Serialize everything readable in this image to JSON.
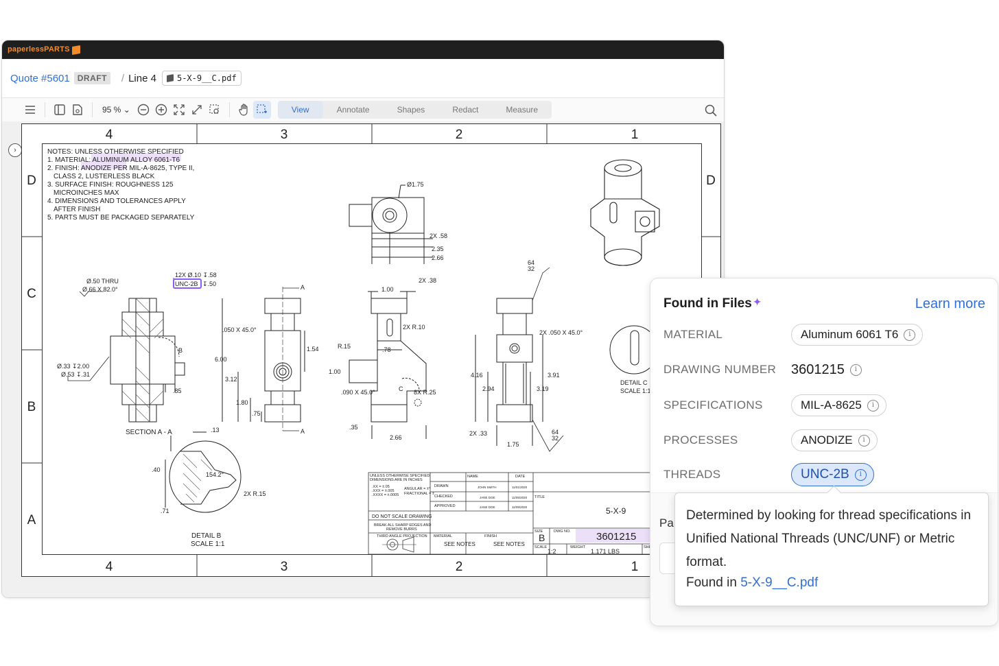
{
  "brand": {
    "name_lower": "paperless",
    "name_upper": "PARTS"
  },
  "header": {
    "quote": "Quote #5601",
    "status": "DRAFT",
    "separator": "/",
    "line": "Line 4",
    "file": "5-X-9__C.pdf"
  },
  "toolbar": {
    "zoom": "95 %",
    "tabs": [
      "View",
      "Annotate",
      "Shapes",
      "Redact",
      "Measure"
    ]
  },
  "drawing": {
    "zones_cols": [
      "4",
      "3",
      "2",
      "1"
    ],
    "zones_rows": [
      "D",
      "C",
      "B",
      "A"
    ],
    "notes": [
      "NOTES: UNLESS OTHERWISE SPECIFIED",
      "1. MATERIAL: ALUMINUM ALLOY 6061-T6",
      "2. FINISH: ANODIZE PER MIL-A-8625, TYPE II,",
      "CLASS 2, LUSTERLESS BLACK",
      "3. SURFACE FINISH: ROUGHNESS 125",
      "MICROINCHES MAX",
      "4. DIMENSIONS AND TOLERANCES APPLY",
      "AFTER FINISH",
      "5. PARTS MUST BE PACKAGED SEPARATELY"
    ],
    "dims": {
      "d175": "Ø1.75",
      "x58": "2X .58",
      "d235": "2.35",
      "d266": "2.66",
      "thru": "Ø.50 THRU",
      "csk": "Ø.66 X 82.0°",
      "holes": "12X Ø.10 ↧.58",
      "thread": "UNC-2B",
      "thread_depth": "↧.50",
      "cb1": "Ø.33 ↧2.00",
      "cb2": "Ø.53 ↧.31",
      "d85": ".85",
      "sectionA": "SECTION A - A",
      "A": "A",
      "B": "B",
      "ch050": ".050 X 45.0°",
      "d600": "6.00",
      "d312": "3.12",
      "d180": "1.80",
      "d75": ".75",
      "d154": "1.54",
      "x38": "2X .38",
      "d100": "1.00",
      "r10": "2X R.10",
      "r15": "R.15",
      "d78": ".78",
      "d100b": "1.00",
      "ch090": ".090 X 45.0°",
      "r25": "8X R.25",
      "d35": ".35",
      "d266b": "2.66",
      "C": "C",
      "sf64": "64",
      "sf32": "32",
      "ch050b": "2X .050 X 45.0°",
      "d416": "4.16",
      "d294": "2.94",
      "d391": "3.91",
      "d319": "3.19",
      "x33": "2X .33",
      "d175b": "1.75",
      "detailC": "DETAIL C",
      "scaleC": "SCALE 1:1",
      "d13": ".13",
      "d40": ".40",
      "ang": "154.2°",
      "r15b": "2X R.15",
      "d71": ".71",
      "detailB": "DETAIL B",
      "scaleB": "SCALE 1:1"
    },
    "title_block": {
      "spec": "UNLESS OTHERWISE SPECIFIED:",
      "inches": "DIMENSIONS ARE IN INCHES",
      "tol": ".XX = ±.05",
      "tol2": ".XXX = ±.005",
      "tol3": ".XXXX = ±.0005",
      "angular": "ANGULAR = ±°",
      "fractional": "FRACTIONAL = ±",
      "name": "NAME",
      "date": "DATE",
      "drawn": "DRAWN",
      "checked": "CHECKED",
      "approved": "APPROVED",
      "drawn_by": "JOHN SMITH",
      "checked_by": "JANE DOE",
      "approved_by": "JANE DOE",
      "drawn_date": "11/01/2020",
      "checked_date": "11/05/2020",
      "approved_date": "11/09/2020",
      "noscale": "DO NOT SCALE DRAWING",
      "break": "BREAK ALL SHARP EDGES AND",
      "burrs": "REMOVE BURRS",
      "projection": "THIRD ANGLE PROJECTION",
      "material": "MATERIAL",
      "finish": "FINISH",
      "see1": "SEE NOTES",
      "see2": "SEE NOTES",
      "title": "TITLE",
      "title_val": "5-X-9",
      "size": "SIZE",
      "size_val": "B",
      "dwgno": "DWG NO.",
      "dwg_val": "3601215",
      "scale": "SCALE",
      "scale_val": "1:2",
      "weight": "WEIGHT",
      "weight_val": "1.171 LBS",
      "sheet": "SHE"
    }
  },
  "panel": {
    "title": "Found in Files",
    "learn_more": "Learn more",
    "rows": [
      {
        "label": "MATERIAL",
        "value": "Aluminum 6061 T6"
      },
      {
        "label": "DRAWING NUMBER",
        "value": "3601215"
      },
      {
        "label": "SPECIFICATIONS",
        "value": "MIL-A-8625"
      },
      {
        "label": "PROCESSES",
        "value": "ANODIZE"
      },
      {
        "label": "THREADS",
        "value": "UNC-2B"
      }
    ],
    "lower_label": "Pa"
  },
  "tooltip": {
    "text": "Determined by looking for thread specifications in Unified National Threads (UNC/UNF) or Metric format.",
    "found_prefix": "Found in",
    "found_file": "5-X-9__C.pdf"
  },
  "colors": {
    "accent": "#2f6fd6",
    "brand": "#f28c28",
    "highlight": "#e9dcf7",
    "thread_box": "#8b5cf6"
  }
}
